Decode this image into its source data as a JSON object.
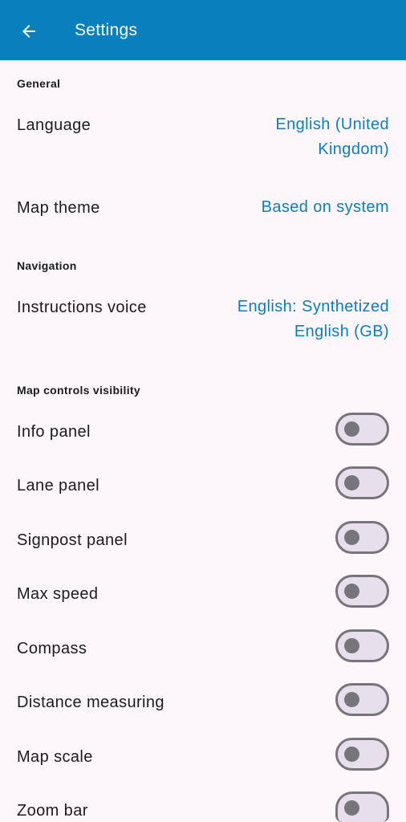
{
  "app_bar": {
    "title": "Settings",
    "back_icon": "arrow-back-icon"
  },
  "general": {
    "header": "General",
    "language": {
      "label": "Language",
      "value_line1": "English (United",
      "value_line2": "Kingdom)"
    },
    "map_theme": {
      "label": "Map theme",
      "value": "Based on system"
    }
  },
  "navigation": {
    "header": "Navigation",
    "instructions_voice": {
      "label": "Instructions voice",
      "value_line1": "English: Synthetized",
      "value_line2": "English (GB)"
    }
  },
  "map_controls": {
    "header": "Map controls visibility",
    "items": [
      {
        "label": "Info panel",
        "enabled": false
      },
      {
        "label": "Lane panel",
        "enabled": false
      },
      {
        "label": "Signpost panel",
        "enabled": false
      },
      {
        "label": "Max speed",
        "enabled": false
      },
      {
        "label": "Compass",
        "enabled": false
      },
      {
        "label": "Distance measuring",
        "enabled": false
      },
      {
        "label": "Map scale",
        "enabled": false
      },
      {
        "label": "Zoom bar",
        "enabled": false
      }
    ]
  },
  "colors": {
    "app_bar": "#0a7fbd",
    "accent": "#0a7fbd",
    "background": "#fdf7fb",
    "switch_off_track": "#e7e0ec",
    "switch_off_border": "#77757c"
  }
}
